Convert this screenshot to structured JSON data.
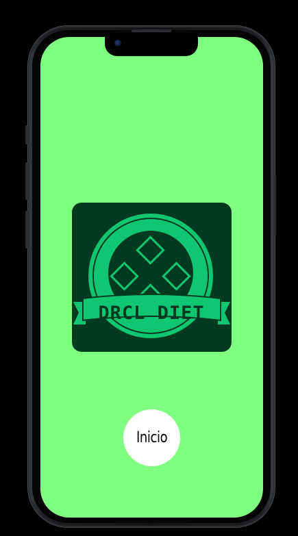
{
  "app": {
    "logo_text": "DRCL DIET",
    "colors": {
      "screen_background": "#80ff80",
      "logo_background": "#003a20",
      "logo_accent": "#10c673",
      "button_background": "#ffffff"
    }
  },
  "main": {
    "start_button_label": "Inicio"
  },
  "icons": {
    "camera": "front-camera-icon",
    "logo": "drcl-diet-logo"
  }
}
